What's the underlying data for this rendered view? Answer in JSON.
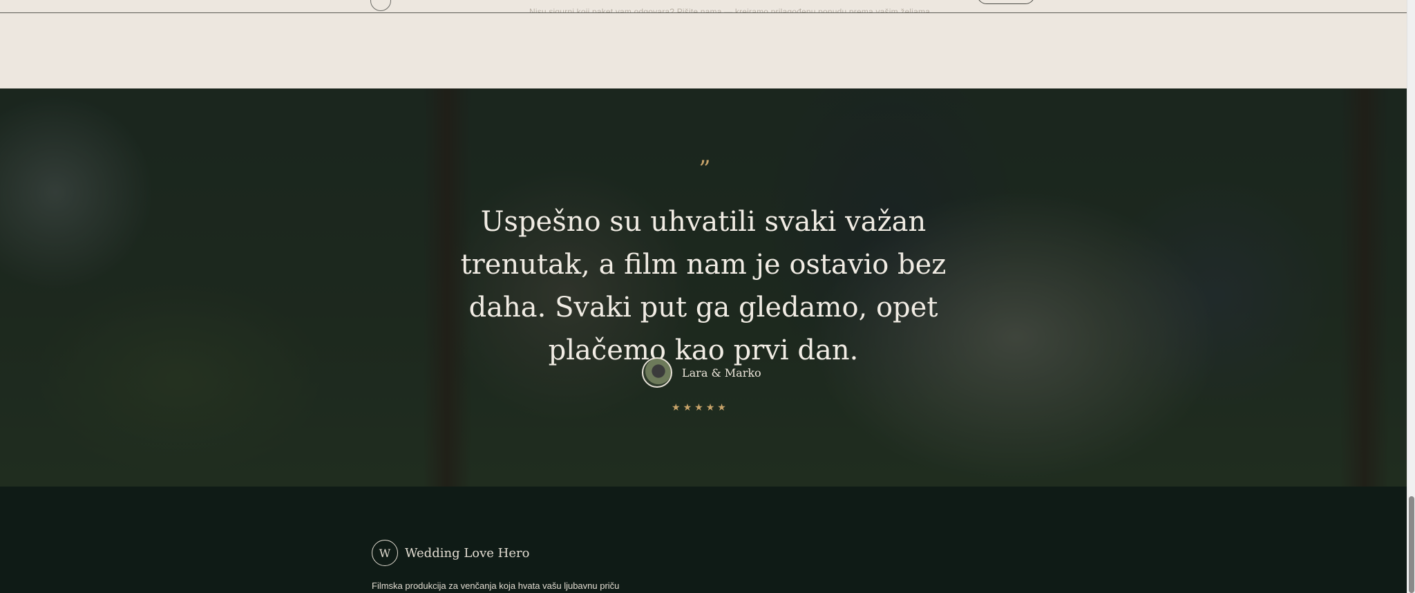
{
  "top_section": {
    "note": "Nisu sigurni koji paket vam odgovara? Pišite nama — kreiramo prilagođenu ponudu prema vašim željama."
  },
  "testimonial": {
    "quote_mark": "”",
    "quote": "Uspešno su uhvatili svaki važan trenutak, a film nam je ostavio bez daha. Svaki put ga gledamo, opet plačemo kao prvi dan.",
    "author": "Lara & Marko",
    "rating": 5,
    "stars": [
      "★",
      "★",
      "★",
      "★",
      "★"
    ],
    "accent_color": "#c8a46a"
  },
  "footer": {
    "logo_letter": "W",
    "brand": "Wedding Love Hero",
    "tagline": "Filmska produkcija za venčanja koja hvata vašu ljubavnu priču"
  }
}
